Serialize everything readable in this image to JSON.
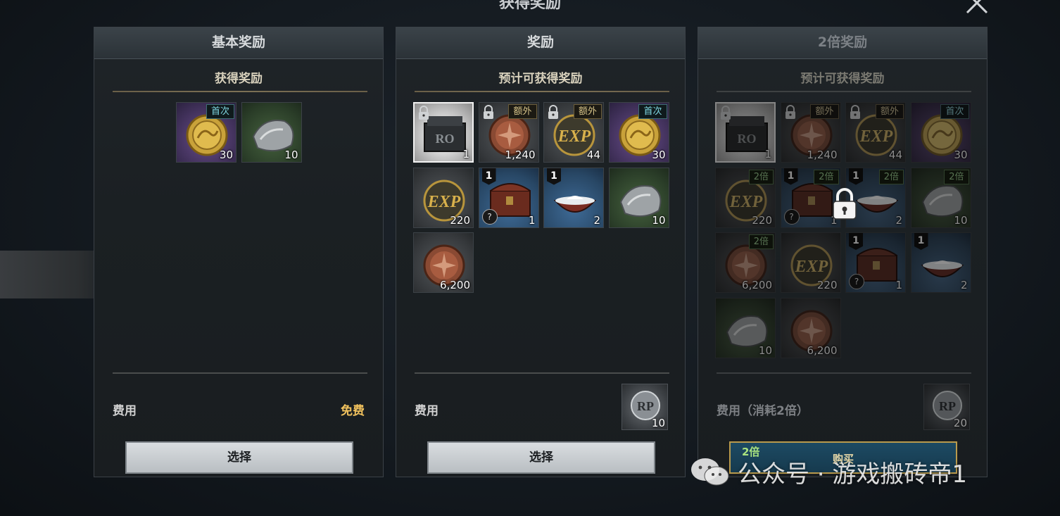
{
  "dialog": {
    "title": "获得奖励"
  },
  "panels": [
    {
      "header": "基本奖励",
      "subtitle": "获得奖励",
      "cost_label": "费用",
      "cost_value": "免费",
      "button": "选择",
      "items": [
        {
          "icon": "gold-dragon-coin-icon",
          "qty": "30",
          "tag": "首次"
        },
        {
          "icon": "silver-ore-icon",
          "qty": "10"
        }
      ]
    },
    {
      "header": "奖励",
      "subtitle": "预计可获得奖励",
      "cost_label": "费用",
      "cost_qty": "10",
      "button": "选择",
      "items": [
        {
          "icon": "iron-chest-icon",
          "qty": "1",
          "locked": true
        },
        {
          "icon": "bronze-star-coin-icon",
          "qty": "1,240",
          "tag": "额外",
          "locked": true
        },
        {
          "icon": "exp-coin-icon",
          "qty": "44",
          "tag": "额外",
          "locked": true
        },
        {
          "icon": "gold-dragon-coin-icon",
          "qty": "30",
          "tag": "首次"
        },
        {
          "icon": "exp-coin-icon",
          "qty": "220"
        },
        {
          "icon": "treasure-chest-icon",
          "qty": "1",
          "badge": "1",
          "help": "?"
        },
        {
          "icon": "salt-bowl-icon",
          "qty": "2",
          "badge": "1"
        },
        {
          "icon": "silver-ore-icon",
          "qty": "10"
        },
        {
          "icon": "bronze-star-coin-icon",
          "qty": "6,200"
        }
      ]
    },
    {
      "header": "2倍奖励",
      "subtitle": "预计可获得奖励",
      "cost_label": "费用（消耗2倍）",
      "cost_qty": "20",
      "button_tag": "2倍",
      "button": "购买",
      "items": [
        {
          "icon": "iron-chest-icon",
          "qty": "1",
          "locked": true
        },
        {
          "icon": "bronze-star-coin-icon",
          "qty": "1,240",
          "tag": "额外",
          "locked": true
        },
        {
          "icon": "exp-coin-icon",
          "qty": "44",
          "tag": "额外",
          "locked": true
        },
        {
          "icon": "gold-dragon-coin-icon",
          "qty": "30",
          "tag": "首次"
        },
        {
          "icon": "exp-coin-icon",
          "qty": "220",
          "tag": "2倍"
        },
        {
          "icon": "treasure-chest-icon",
          "qty": "1",
          "badge": "1",
          "help": "?",
          "tag": "2倍"
        },
        {
          "icon": "salt-bowl-icon",
          "qty": "2",
          "badge": "1",
          "tag": "2倍"
        },
        {
          "icon": "silver-ore-icon",
          "qty": "10",
          "tag": "2倍"
        },
        {
          "icon": "bronze-star-coin-icon",
          "qty": "6,200",
          "tag": "2倍"
        },
        {
          "icon": "exp-coin-icon",
          "qty": "220"
        },
        {
          "icon": "treasure-chest-icon",
          "qty": "1",
          "badge": "1",
          "help": "?"
        },
        {
          "icon": "salt-bowl-icon",
          "qty": "2",
          "badge": "1"
        },
        {
          "icon": "silver-ore-icon",
          "qty": "10"
        },
        {
          "icon": "bronze-star-coin-icon",
          "qty": "6,200"
        }
      ]
    }
  ],
  "watermark": {
    "text": "公众号 · 游戏搬砖帝1"
  }
}
